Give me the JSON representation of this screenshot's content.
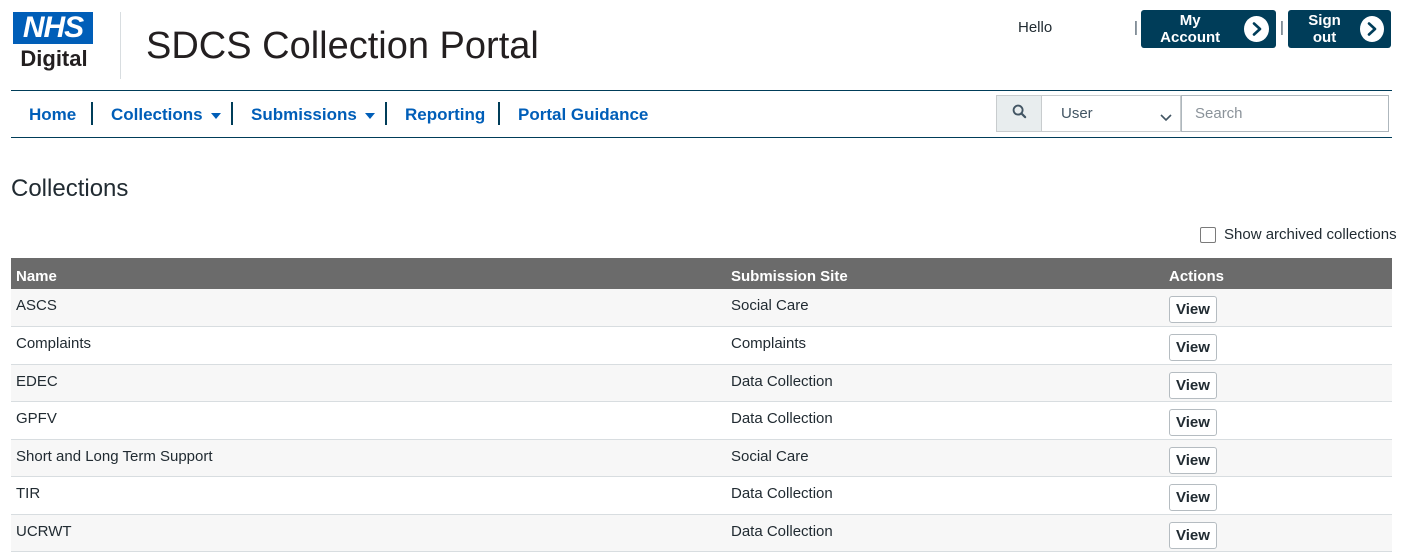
{
  "header": {
    "logo_nhs": "NHS",
    "logo_digital": "Digital",
    "title": "SDCS Collection Portal",
    "greeting": "Hello",
    "pipe": "|",
    "my_account_label": "My Account",
    "sign_out_label": "Sign out"
  },
  "nav": {
    "items": [
      {
        "label": "Home"
      },
      {
        "label": "Collections"
      },
      {
        "label": "Submissions"
      },
      {
        "label": "Reporting"
      },
      {
        "label": "Portal Guidance"
      }
    ],
    "search_scope": "User",
    "search_placeholder": "Search"
  },
  "main": {
    "title": "Collections",
    "show_archived_label": "Show archived collections",
    "show_archived_checked": false,
    "table": {
      "headers": [
        "Name",
        "Submission Site",
        "Actions"
      ],
      "rows": [
        {
          "name": "ASCS",
          "site": "Social Care",
          "action": "View"
        },
        {
          "name": "Complaints",
          "site": "Complaints",
          "action": "View"
        },
        {
          "name": "EDEC",
          "site": "Data Collection",
          "action": "View"
        },
        {
          "name": "GPFV",
          "site": "Data Collection",
          "action": "View"
        },
        {
          "name": "Short and Long Term Support",
          "site": "Social Care",
          "action": "View"
        },
        {
          "name": "TIR",
          "site": "Data Collection",
          "action": "View"
        },
        {
          "name": "UCRWT",
          "site": "Data Collection",
          "action": "View"
        }
      ]
    }
  },
  "colors": {
    "nhs_blue": "#005eb8",
    "dark_navy": "#003d59",
    "table_header": "#6b6b6b"
  }
}
